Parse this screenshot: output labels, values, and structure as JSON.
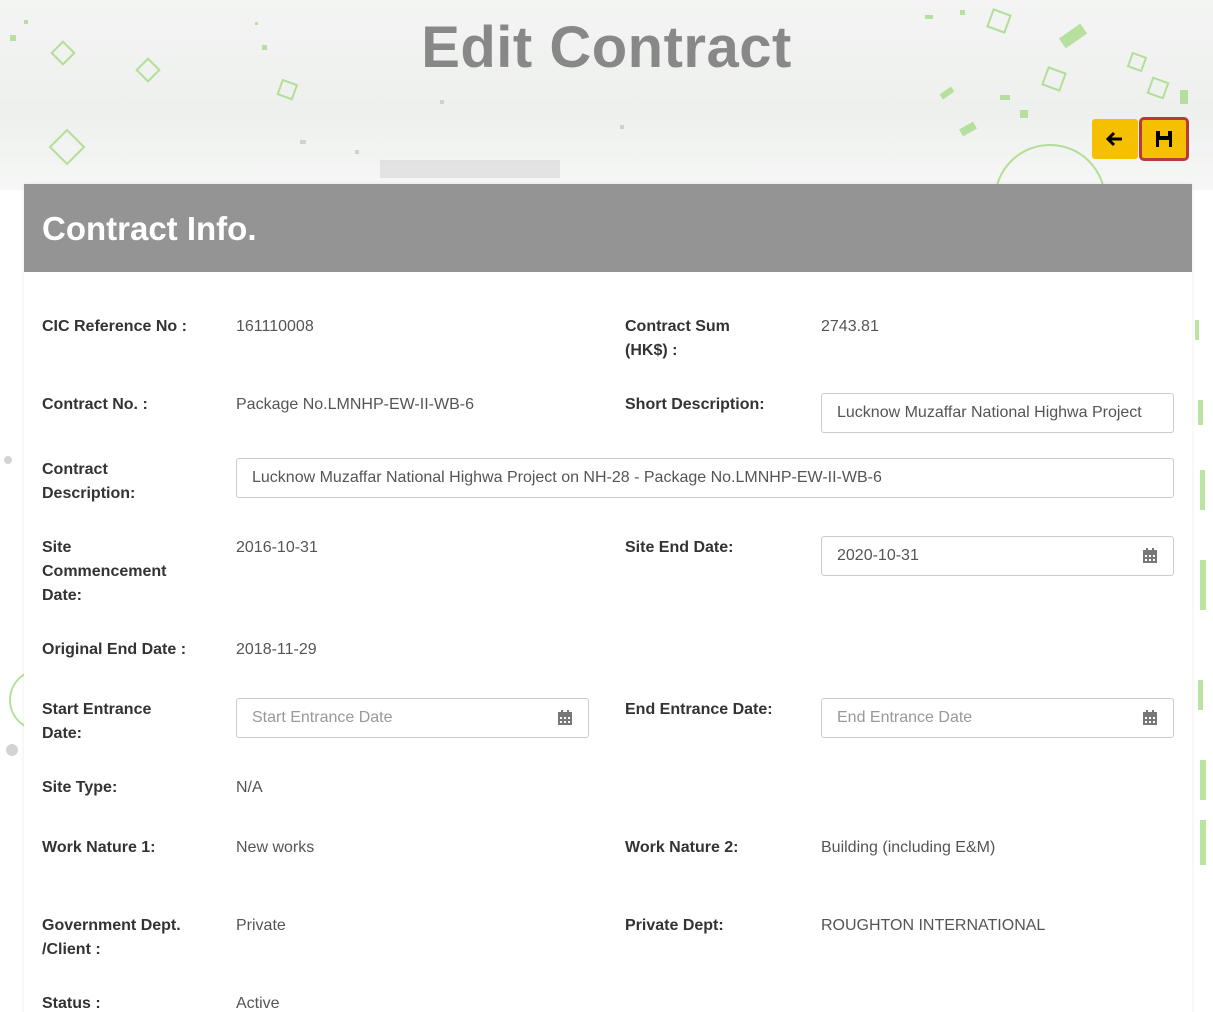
{
  "page": {
    "title": "Edit Contract"
  },
  "toolbar": {
    "back_icon": "arrow-left-icon",
    "save_icon": "floppy-disk-icon"
  },
  "panel": {
    "title": "Contract Info."
  },
  "fields": {
    "cic_ref": {
      "label": "CIC Reference No :",
      "value": "161110008"
    },
    "contract_sum": {
      "label_line1": "Contract Sum",
      "label_line2": "(HK$) :",
      "value": "2743.81"
    },
    "contract_no": {
      "label": "Contract No. :",
      "value": "Package No.LMNHP-EW-II-WB-6"
    },
    "short_desc": {
      "label": "Short Description:",
      "value": "Lucknow Muzaffar National Highwa Project"
    },
    "contract_desc": {
      "label_line1": "Contract",
      "label_line2": "Description:",
      "value": "Lucknow Muzaffar National Highwa Project on NH-28 - Package No.LMNHP-EW-II-WB-6"
    },
    "site_commencement": {
      "label_line1": "Site",
      "label_line2": "Commencement",
      "label_line3": "Date:",
      "value": "2016-10-31"
    },
    "site_end": {
      "label": "Site End Date:",
      "value": "2020-10-31"
    },
    "original_end": {
      "label": "Original End Date :",
      "value": "2018-11-29"
    },
    "start_entrance": {
      "label_line1": "Start Entrance",
      "label_line2": "Date:",
      "placeholder": "Start Entrance Date"
    },
    "end_entrance": {
      "label": "End Entrance Date:",
      "placeholder": "End Entrance Date"
    },
    "site_type": {
      "label": "Site Type:",
      "value": "N/A"
    },
    "work_nature_1": {
      "label": "Work Nature 1:",
      "value": "New works"
    },
    "work_nature_2": {
      "label": "Work Nature 2:",
      "value": "Building (including E&M)"
    },
    "gov_dept": {
      "label_line1": "Government Dept.",
      "label_line2": "/Client :",
      "value": "Private"
    },
    "private_dept": {
      "label": "Private Dept:",
      "value": "ROUGHTON INTERNATIONAL"
    },
    "status": {
      "label": "Status :",
      "value": "Active"
    }
  },
  "colors": {
    "accent_button": "#f5c000",
    "panel_header": "#949494",
    "save_highlight": "#b83a3a",
    "deco_green": "#8fd16a"
  }
}
